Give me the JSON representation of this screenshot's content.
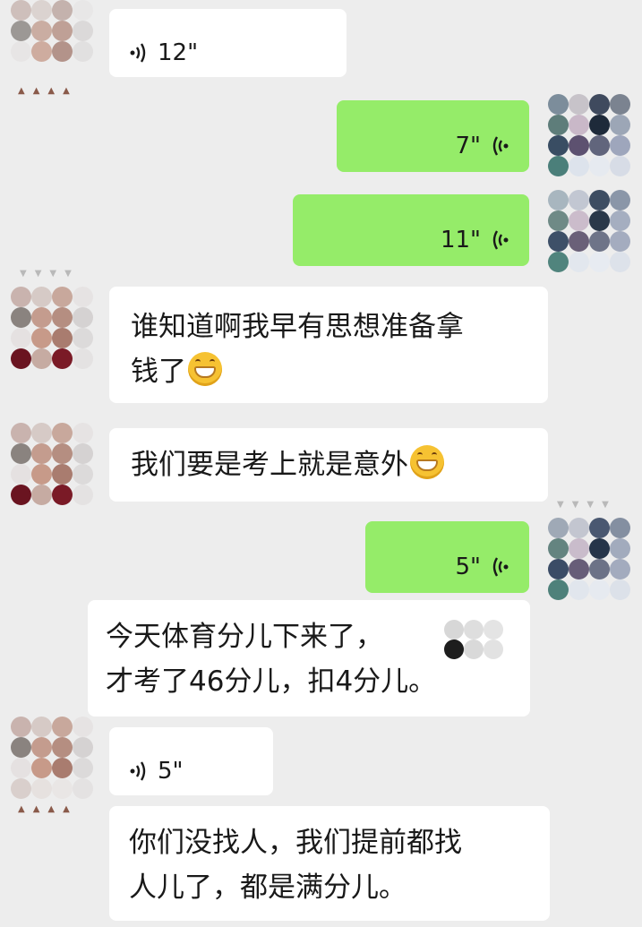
{
  "messages": {
    "m1": {
      "side": "left",
      "type": "voice",
      "duration": "12\""
    },
    "m2": {
      "side": "right",
      "type": "voice",
      "duration": "7\""
    },
    "m3": {
      "side": "right",
      "type": "voice",
      "duration": "11\""
    },
    "m4": {
      "side": "left",
      "type": "text",
      "line1": "谁知道啊我早有思想准备拿",
      "line2": "钱了"
    },
    "m5": {
      "side": "left",
      "type": "text",
      "text": "我们要是考上就是意外"
    },
    "m6": {
      "side": "right",
      "type": "voice",
      "duration": "5\""
    },
    "m7": {
      "side": "left",
      "type": "text",
      "line1": "今天体育分儿下来了，",
      "line2": "才考了46分儿，扣4分儿。"
    },
    "m8": {
      "side": "left",
      "type": "voice",
      "duration": "5\""
    },
    "m9": {
      "side": "left",
      "type": "text",
      "line1": "你们没找人，我们提前都找",
      "line2": "人儿了，都是满分儿。"
    }
  },
  "icons": {
    "voice": "voice-wave-icon",
    "emoji": "grin-emoji-icon",
    "avatar": "pixelated-avatar"
  },
  "colors": {
    "background": "#ededed",
    "left_bubble": "#ffffff",
    "right_bubble": "#95ec69",
    "text": "#191919"
  }
}
